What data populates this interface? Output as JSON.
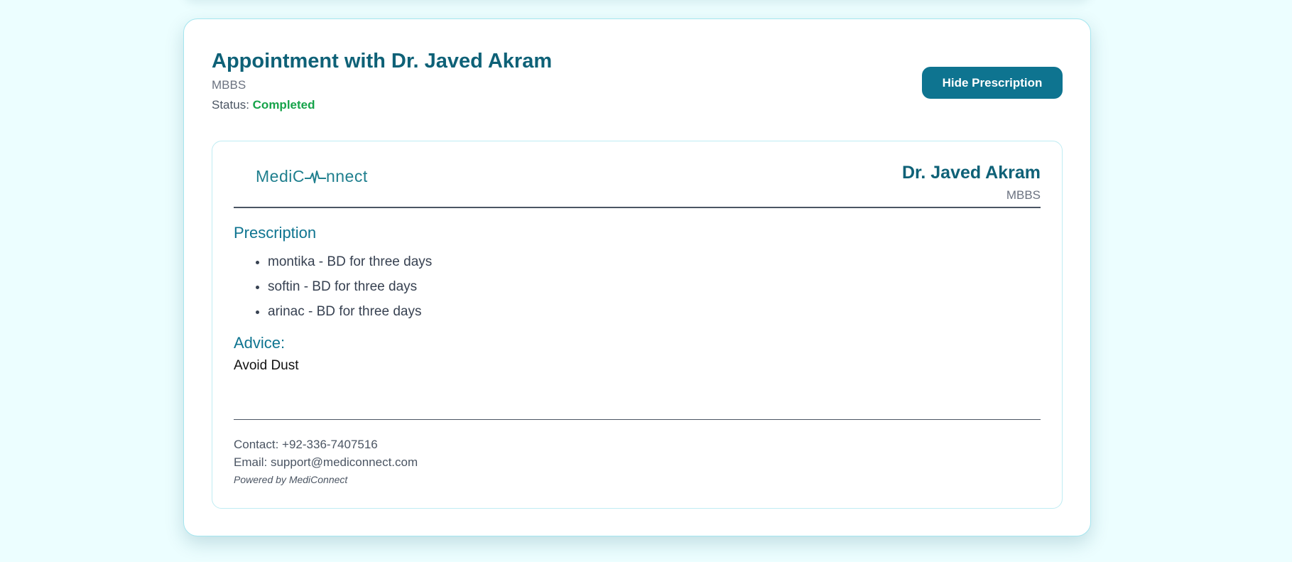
{
  "appointment": {
    "title": "Appointment with Dr. Javed Akram",
    "qualification": "MBBS",
    "status_label": "Status:",
    "status_value": "Completed",
    "toggle_button": "Hide Prescription"
  },
  "prescription_card": {
    "logo_text_left": "MediC",
    "logo_text_right": "nnect",
    "doctor_name": "Dr. Javed Akram",
    "doctor_qualification": "MBBS",
    "prescription_heading": "Prescription",
    "medicines": [
      "montika - BD for three days",
      "softin - BD for three days",
      "arinac - BD for three days"
    ],
    "advice_heading": "Advice:",
    "advice_text": "Avoid Dust",
    "contact": "Contact: +92-336-7407516",
    "email": "Email: support@mediconnect.com",
    "powered_by": "Powered by MediConnect"
  },
  "colors": {
    "page_bg": "#ecfeff",
    "primary": "#0e7490",
    "title": "#0e6177",
    "status_completed": "#16a34a",
    "logo": "#1f7f8e"
  }
}
